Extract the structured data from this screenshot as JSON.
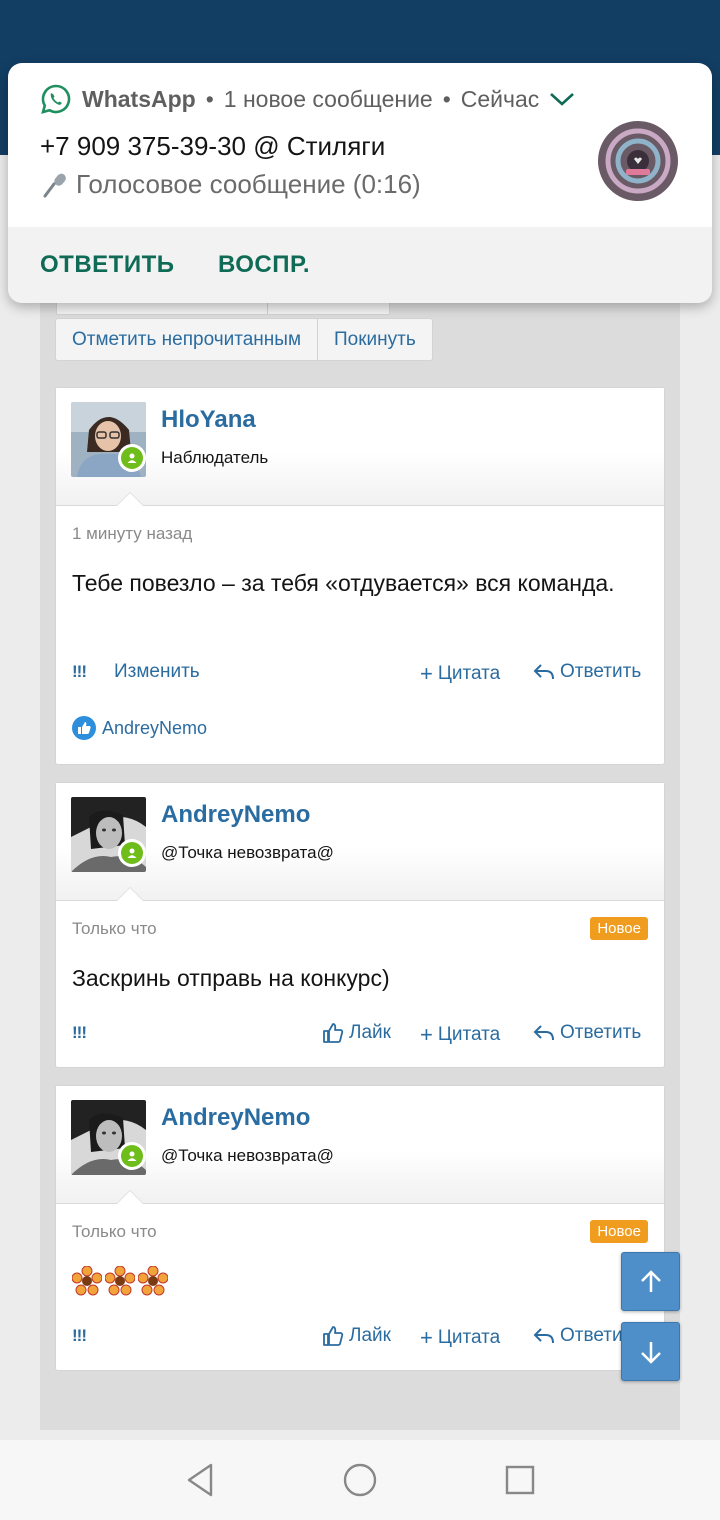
{
  "notification": {
    "app": "WhatsApp",
    "meta": "1 новое сообщение",
    "time": "Сейчас",
    "title": "+7 909 375-39-30 @ Стиляги",
    "message": "Голосовое сообщение (0:16)",
    "action_reply": "ОТВЕТИТЬ",
    "action_play": "ВОСПР.",
    "colors": {
      "accent": "#0f6b55",
      "whatsapp": "#25d366"
    }
  },
  "thread_buttons": {
    "mark_unread": "Отметить непрочитанным",
    "leave": "Покинуть"
  },
  "posts": [
    {
      "username": "HloYana",
      "user_title": "Наблюдатель",
      "time": "1 минуту назад",
      "text": "Тебе повезло – за тебя «отдувается» вся команда.",
      "report": "!!!",
      "edit": "Изменить",
      "quote": "Цитата",
      "reply": "Ответить",
      "liked_by": "AndreyNemo"
    },
    {
      "username": "AndreyNemo",
      "user_title": "@Точка невозврата@",
      "time": "Только что",
      "badge": "Новое",
      "text": "Заскринь отправь на конкурс)",
      "report": "!!!",
      "like": "Лайк",
      "quote": "Цитата",
      "reply": "Ответить"
    },
    {
      "username": "AndreyNemo",
      "user_title": "@Точка невозврата@",
      "time": "Только что",
      "badge": "Новое",
      "emoji_count": 3,
      "report": "!!!",
      "like": "Лайк",
      "quote": "Цитата",
      "reply": "Ответить"
    }
  ],
  "colors": {
    "topbar": "#123e64",
    "link": "#2b6ca0",
    "badge": "#f09d1f",
    "online": "#6fbd1b",
    "fab": "#4f8fc9"
  }
}
